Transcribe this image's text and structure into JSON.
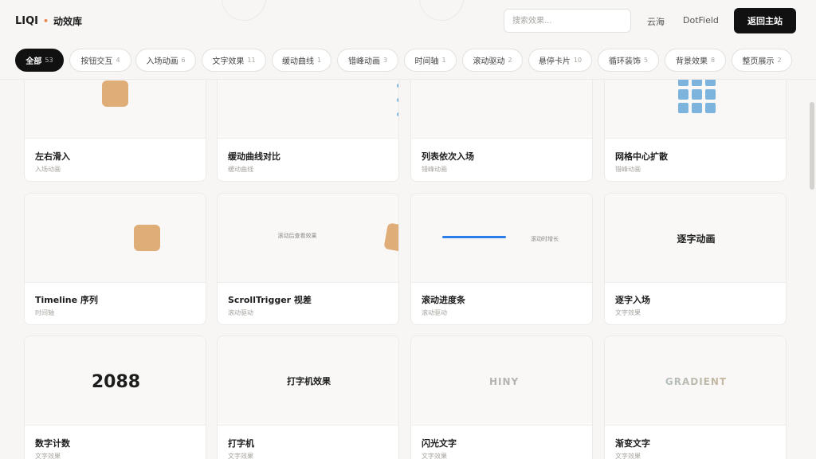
{
  "brand": {
    "name": "LIQI",
    "dot": "•",
    "subtitle": "动效库"
  },
  "header": {
    "search_placeholder": "搜索效果...",
    "links": [
      "云海",
      "DotField"
    ],
    "home_label": "返回主站"
  },
  "filters": [
    {
      "label": "全部",
      "count": "53",
      "active": true
    },
    {
      "label": "按钮交互",
      "count": "4"
    },
    {
      "label": "入场动画",
      "count": "6"
    },
    {
      "label": "文字效果",
      "count": "11"
    },
    {
      "label": "缓动曲线",
      "count": "1"
    },
    {
      "label": "错峰动画",
      "count": "3"
    },
    {
      "label": "时间轴",
      "count": "1"
    },
    {
      "label": "滚动驱动",
      "count": "2"
    },
    {
      "label": "悬停卡片",
      "count": "10"
    },
    {
      "label": "循环装饰",
      "count": "5"
    },
    {
      "label": "背景效果",
      "count": "8"
    },
    {
      "label": "整页展示",
      "count": "2"
    }
  ],
  "cards": [
    {
      "title": "左右滑入",
      "tag": "入场动画"
    },
    {
      "title": "缓动曲线对比",
      "tag": "缓动曲线"
    },
    {
      "title": "列表依次入场",
      "tag": "错峰动画"
    },
    {
      "title": "网格中心扩散",
      "tag": "错峰动画"
    },
    {
      "title": "Timeline 序列",
      "tag": "时间轴"
    },
    {
      "title": "ScrollTrigger 视差",
      "tag": "滚动驱动",
      "preview_text": "滚动后查看效果"
    },
    {
      "title": "滚动进度条",
      "tag": "滚动驱动",
      "preview_text": "滚动时增长"
    },
    {
      "title": "逐字入场",
      "tag": "文字效果",
      "preview_text": "逐字动画"
    },
    {
      "title": "数字计数",
      "tag": "文字效果",
      "preview_text": "2088"
    },
    {
      "title": "打字机",
      "tag": "文字效果",
      "preview_text": "打字机效果"
    },
    {
      "title": "闪光文字",
      "tag": "文字效果",
      "preview_text": "HINY"
    },
    {
      "title": "渐变文字",
      "tag": "文字效果",
      "preview_text": "GRADIENT"
    }
  ],
  "colors": {
    "accent_orange": "#e8824a",
    "block_tan": "#dfae78",
    "bar_blue": "#2b7de9",
    "grid_blue": "#7db4dd"
  }
}
